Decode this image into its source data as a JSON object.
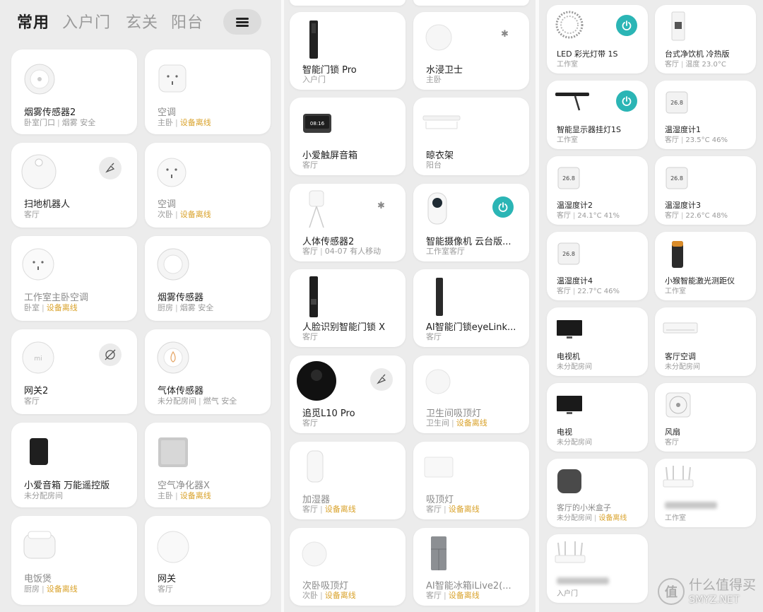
{
  "panel1": {
    "tabs": [
      "常用",
      "入户门",
      "玄关",
      "阳台"
    ],
    "cards": [
      {
        "name": "烟雾传感器2",
        "room": "卧室门口",
        "status": "烟雾 安全",
        "offline": false
      },
      {
        "name": "空调",
        "room": "主卧",
        "status": "设备离线",
        "offline": true
      },
      {
        "name": "扫地机器人",
        "room": "客厅",
        "status": "",
        "offline": false,
        "action_icon": "sweep-icon"
      },
      {
        "name": "空调",
        "room": "次卧",
        "status": "设备离线",
        "offline": true
      },
      {
        "name": "工作室主卧空调",
        "room": "卧室",
        "status": "设备离线",
        "offline": true
      },
      {
        "name": "烟雾传感器",
        "room": "厨房",
        "status": "烟雾 安全",
        "offline": false
      },
      {
        "name": "网关2",
        "room": "客厅",
        "status": "",
        "offline": false,
        "action_icon": "gateway-off-icon"
      },
      {
        "name": "气体传感器",
        "room": "未分配房间",
        "status": "燃气 安全",
        "offline": false
      },
      {
        "name": "小爱音箱 万能遥控版",
        "room": "未分配房间",
        "status": "",
        "offline": false
      },
      {
        "name": "空气净化器X",
        "room": "主卧",
        "status": "设备离线",
        "offline": true
      },
      {
        "name": "电饭煲",
        "room": "厨房",
        "status": "设备离线",
        "offline": true
      },
      {
        "name": "网关",
        "room": "客厅",
        "status": "",
        "offline": false
      }
    ]
  },
  "panel2": {
    "cards": [
      {
        "name": "智能门锁 Pro",
        "room": "入户门",
        "status": "",
        "offline": false
      },
      {
        "name": "水浸卫士",
        "room": "主卧",
        "status": "",
        "offline": false,
        "action_icon": "bluetooth-icon"
      },
      {
        "name": "小爱触屏音箱",
        "room": "客厅",
        "status": "",
        "offline": false,
        "screen_text": "08:16"
      },
      {
        "name": "晾衣架",
        "room": "阳台",
        "status": "",
        "offline": false
      },
      {
        "name": "人体传感器2",
        "room": "客厅",
        "status": "04-07 有人移动",
        "offline": false,
        "action_icon": "bluetooth-icon"
      },
      {
        "name": "智能摄像机 云台版...",
        "room": "工作室客厅",
        "status": "",
        "offline": false,
        "action_icon": "power-icon"
      },
      {
        "name": "人脸识别智能门锁 X",
        "room": "客厅",
        "status": "",
        "offline": false
      },
      {
        "name": "AI智能门锁eyeLink...",
        "room": "客厅",
        "status": "",
        "offline": false
      },
      {
        "name": "追觅L10 Pro",
        "room": "客厅",
        "status": "",
        "offline": false,
        "action_icon": "sweep-icon"
      },
      {
        "name": "卫生间吸顶灯",
        "room": "卫生间",
        "status": "设备离线",
        "offline": true
      },
      {
        "name": "加湿器",
        "room": "客厅",
        "status": "设备离线",
        "offline": true
      },
      {
        "name": "吸顶灯",
        "room": "客厅",
        "status": "设备离线",
        "offline": true
      },
      {
        "name": "次卧吸顶灯",
        "room": "次卧",
        "status": "设备离线",
        "offline": true
      },
      {
        "name": "AI智能冰箱iLive2(...",
        "room": "客厅",
        "status": "设备离线",
        "offline": true
      }
    ]
  },
  "panel3": {
    "cards": [
      {
        "name": "LED 彩光灯带 1S",
        "room": "工作室",
        "status": "",
        "offline": false,
        "action_icon": "power-icon"
      },
      {
        "name": "台式净饮机 冷热版",
        "room": "客厅",
        "status": "温度 23.0°C",
        "offline": false
      },
      {
        "name": "智能显示器挂灯1S",
        "room": "工作室",
        "status": "",
        "offline": false,
        "action_icon": "power-icon"
      },
      {
        "name": "温湿度计1",
        "room": "客厅",
        "status": "23.5°C 46%",
        "offline": false,
        "screen_text": "26.8"
      },
      {
        "name": "温湿度计2",
        "room": "客厅",
        "status": "24.1°C 41%",
        "offline": false,
        "screen_text": "26.8"
      },
      {
        "name": "温湿度计3",
        "room": "客厅",
        "status": "22.6°C 48%",
        "offline": false,
        "screen_text": "26.8"
      },
      {
        "name": "温湿度计4",
        "room": "客厅",
        "status": "22.7°C 46%",
        "offline": false,
        "screen_text": "26.8"
      },
      {
        "name": "小猴智能激光测距仪",
        "room": "工作室",
        "status": "",
        "offline": false
      },
      {
        "name": "电视机",
        "room": "未分配房间",
        "status": "",
        "offline": false
      },
      {
        "name": "客厅空调",
        "room": "未分配房间",
        "status": "",
        "offline": false
      },
      {
        "name": "电视",
        "room": "未分配房间",
        "status": "",
        "offline": false
      },
      {
        "name": "风扇",
        "room": "客厅",
        "status": "",
        "offline": false
      },
      {
        "name": "客厅的小米盒子",
        "room": "未分配房间",
        "status": "设备离线",
        "offline": true
      },
      {
        "name": "",
        "room": "工作室",
        "status": "",
        "offline": false,
        "blurred": true
      },
      {
        "name": "",
        "room": "入户门",
        "status": "",
        "offline": false,
        "blurred": true
      }
    ]
  },
  "watermark": {
    "logo": "值",
    "text": "什么值得买",
    "site": "SMYZ.NET"
  },
  "colors": {
    "accent": "#2bb5b5",
    "offline": "#d9a22a"
  }
}
